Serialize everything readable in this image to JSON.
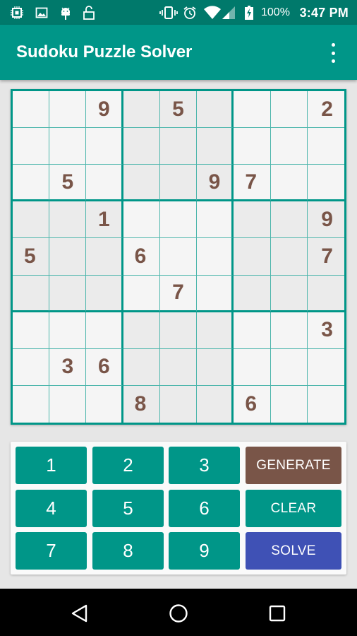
{
  "status_bar": {
    "left_icons": [
      "chip-icon",
      "image-icon",
      "android-icon",
      "unlock-icon"
    ],
    "right_icons": [
      "vibrate-icon",
      "alarm-icon",
      "wifi-icon",
      "signal-icon",
      "battery-charging-icon"
    ],
    "battery": "100%",
    "time": "3:47 PM"
  },
  "app_bar": {
    "title": "Sudoku Puzzle Solver",
    "overflow_icon": "more-vert-icon"
  },
  "board": {
    "rows": [
      [
        "",
        "",
        "9",
        "",
        "5",
        "",
        "",
        "",
        "2"
      ],
      [
        "",
        "",
        "",
        "",
        "",
        "",
        "",
        "",
        ""
      ],
      [
        "",
        "5",
        "",
        "",
        "",
        "9",
        "7",
        "",
        ""
      ],
      [
        "",
        "",
        "1",
        "",
        "",
        "",
        "",
        "",
        "9"
      ],
      [
        "5",
        "",
        "",
        "6",
        "",
        "",
        "",
        "",
        "7"
      ],
      [
        "",
        "",
        "",
        "",
        "7",
        "",
        "",
        "",
        ""
      ],
      [
        "",
        "",
        "",
        "",
        "",
        "",
        "",
        "",
        "3"
      ],
      [
        "",
        "3",
        "6",
        "",
        "",
        "",
        "",
        "",
        ""
      ],
      [
        "",
        "",
        "",
        "8",
        "",
        "",
        "6",
        "",
        ""
      ]
    ]
  },
  "keypad": {
    "numbers": [
      "1",
      "2",
      "3",
      "4",
      "5",
      "6",
      "7",
      "8",
      "9"
    ],
    "actions": [
      {
        "label": "GENERATE",
        "color": "#795548"
      },
      {
        "label": "CLEAR",
        "color": "#009688"
      },
      {
        "label": "SOLVE",
        "color": "#3f51b5"
      }
    ]
  },
  "colors": {
    "primary": "#009688",
    "primary_dark": "#00796b",
    "digit": "#795548",
    "solve": "#3f51b5"
  },
  "nav_bar": {
    "buttons": [
      "back-icon",
      "home-icon",
      "recents-icon"
    ]
  }
}
